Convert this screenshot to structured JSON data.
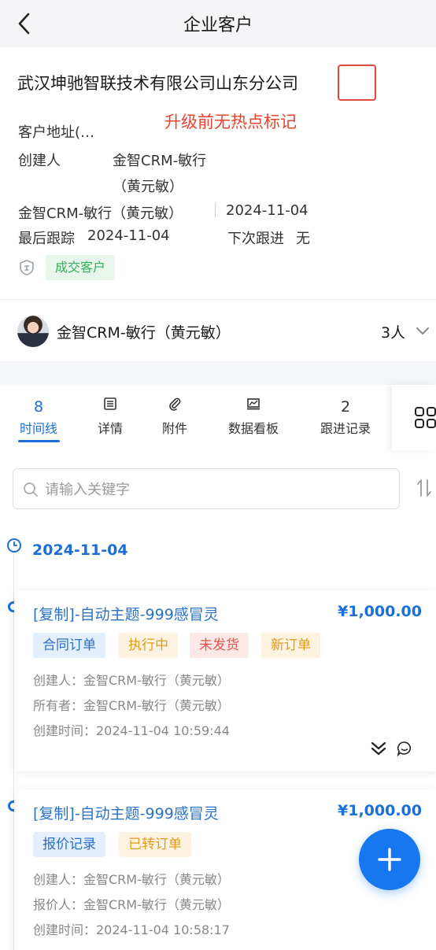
{
  "header": {
    "title": "企业客户",
    "back_icon": "chevron-left-icon"
  },
  "customer": {
    "name": "武汉坤驰智联技术有限公司山东分公司",
    "hotspot_note": "升级前无热点标记",
    "address_label": "客户地址(…",
    "creator_label": "创建人",
    "creator_line1": "金智CRM-敏行",
    "creator_line2": "（黄元敏）",
    "owner_text": "金智CRM-敏行（黄元敏）",
    "created_date": "2024-11-04",
    "last_follow_label": "最后跟踪",
    "last_follow_date": "2024-11-04",
    "next_follow_label": "下次跟进",
    "next_follow_value": "无",
    "status_badge": "成交客户",
    "accent_color": "#1a6fd8"
  },
  "owner_row": {
    "name": "金智CRM-敏行（黄元敏）",
    "member_count": "3人"
  },
  "tabs": [
    {
      "count": "8",
      "label": "时间线",
      "active": true
    },
    {
      "icon": "list-icon",
      "label": "详情"
    },
    {
      "icon": "paperclip-icon",
      "label": "附件"
    },
    {
      "icon": "dashboard-icon",
      "label": "数据看板"
    },
    {
      "count": "2",
      "label": "跟进记录"
    }
  ],
  "search": {
    "placeholder": "请输入关键字"
  },
  "timeline": {
    "date": "2024-11-04",
    "items": [
      {
        "title": "[复制]-自动主题-999感冒灵",
        "amount": "¥1,000.00",
        "tags": [
          "合同订单",
          "执行中",
          "未发货",
          "新订单"
        ],
        "lines": [
          "创建人：金智CRM-敏行（黄元敏）",
          "所有者：金智CRM-敏行（黄元敏）",
          "创建时间：2024-11-04 10:59:44"
        ]
      },
      {
        "title": "[复制]-自动主题-999感冒灵",
        "amount": "¥1,000.00",
        "tags": [
          "报价记录",
          "已转订单"
        ],
        "lines": [
          "创建人：金智CRM-敏行（黄元敏）",
          "报价人：金智CRM-敏行（黄元敏）",
          "创建时间：2024-11-04 10:58:17"
        ]
      }
    ]
  }
}
